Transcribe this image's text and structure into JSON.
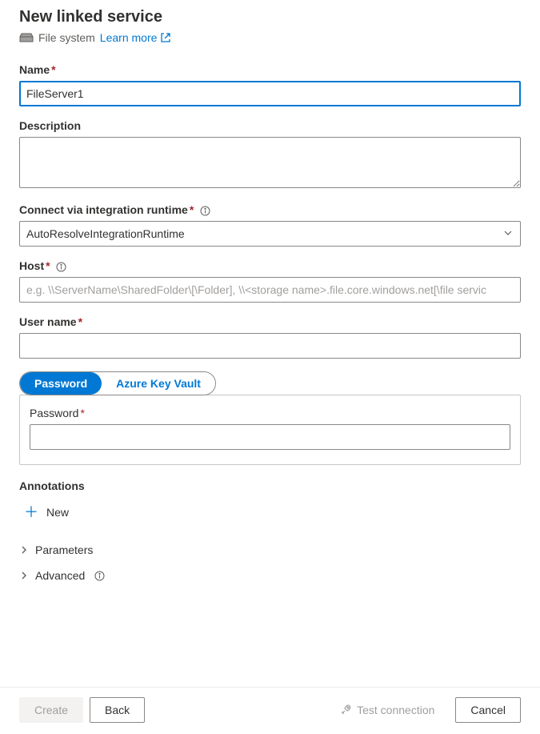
{
  "header": {
    "title": "New linked service",
    "service_type": "File system",
    "learn_more": "Learn more"
  },
  "fields": {
    "name_label": "Name",
    "name_value": "FileServer1",
    "description_label": "Description",
    "description_value": "",
    "runtime_label": "Connect via integration runtime",
    "runtime_value": "AutoResolveIntegrationRuntime",
    "host_label": "Host",
    "host_placeholder": "e.g. \\\\ServerName\\SharedFolder\\[\\Folder], \\\\<storage name>.file.core.windows.net[\\file servic",
    "host_value": "",
    "username_label": "User name",
    "username_value": ""
  },
  "auth_tabs": {
    "password": "Password",
    "akv": "Azure Key Vault",
    "password_field_label": "Password",
    "password_value": ""
  },
  "sections": {
    "annotations": "Annotations",
    "add_new": "New",
    "parameters": "Parameters",
    "advanced": "Advanced"
  },
  "footer": {
    "create": "Create",
    "back": "Back",
    "test": "Test connection",
    "cancel": "Cancel"
  }
}
